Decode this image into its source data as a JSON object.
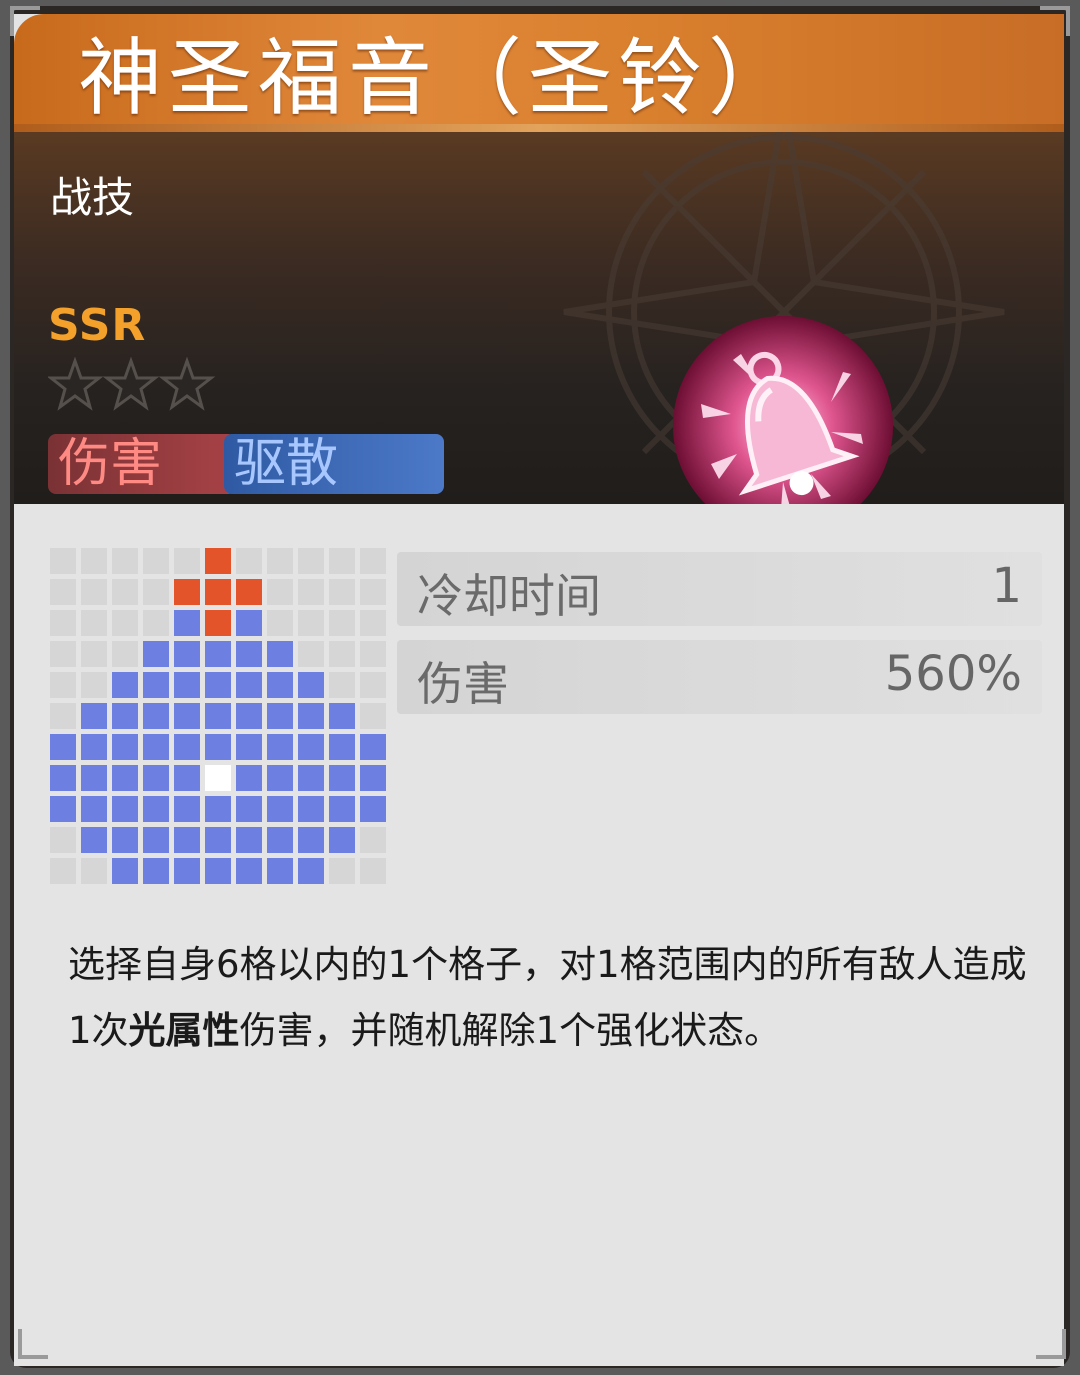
{
  "skill": {
    "name": "神圣福音（圣铃）",
    "type": "战技",
    "rarity": "SSR",
    "stars_filled": 0,
    "stars_total": 3,
    "tags": [
      {
        "label": "伤害",
        "color": "#ff8a84"
      },
      {
        "label": "驱散",
        "color": "#a9c7ff"
      }
    ],
    "icon": "holy-bell-icon"
  },
  "stats": [
    {
      "label": "冷却时间",
      "value": "1"
    },
    {
      "label": "伤害",
      "value": "560%"
    }
  ],
  "description": {
    "part1": "选择自身6格以内的1个格子，对1格范围内的所有敌人造成1次",
    "bold": "光属性",
    "part2": "伤害，并随机解除1个强化状态。"
  },
  "range_grid": {
    "cols": 11,
    "rows": 11,
    "legend": {
      ".": "#d6d6d6",
      "B": "#6d7fe0",
      "O": "#e4542a",
      "W": "#ffffff"
    },
    "cells": [
      ".....O.....",
      "....OOO....",
      "....BOB....",
      "...BBBBB...",
      "..BBBBBBB..",
      ".BBBBBBBBB.",
      "BBBBBBBBBBB",
      "BBBBBWBBBBB",
      "BBBBBBBBBBB",
      ".BBBBBBBBB.",
      "..BBBBBBB.."
    ]
  },
  "colors": {
    "title_bar": "#d9802e",
    "rarity": "#f3a12a",
    "card_bg": "#e4e4e4",
    "range_blue": "#6d7fe0",
    "target_orange": "#e4542a"
  }
}
